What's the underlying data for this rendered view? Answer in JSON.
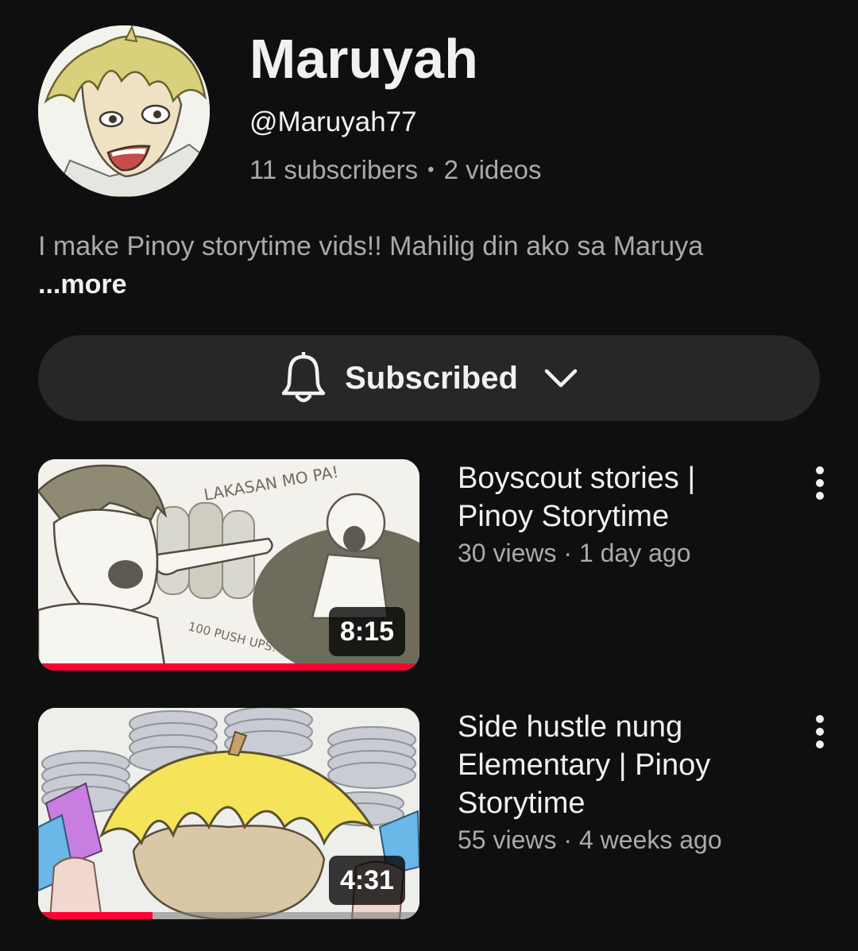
{
  "channel": {
    "name": "Maruyah",
    "handle": "@Maruyah77",
    "subscribers": "11 subscribers",
    "separator": "•",
    "videos": "2 videos",
    "description": "I make Pinoy storytime vids!! Mahilig din ako sa Maruya",
    "more_label": "...more",
    "avatar_icon": "avatar-anime-boy"
  },
  "subscribe_button": {
    "label": "Subscribed",
    "icon": "bell-icon",
    "dropdown_icon": "chevron-down-icon"
  },
  "videos": [
    {
      "title": "Boyscout stories | Pinoy Storytime",
      "views": "30 views",
      "age": "1 day ago",
      "meta": "30 views · 1 day ago",
      "duration": "8:15",
      "watched_fraction": 0.99,
      "thumb_text_top": "LAKASAN MO PA!",
      "thumb_text_bottom": "100 PUSH UPS!"
    },
    {
      "title": "Side hustle nung Elementary | Pinoy Storytime",
      "views": "55 views",
      "age": "4 weeks ago",
      "meta": "55 views · 4 weeks ago",
      "duration": "4:31",
      "watched_fraction": 0.3
    }
  ],
  "colors": {
    "background": "#0f0f0f",
    "button_bg": "#272727",
    "text_primary": "#f1f1f1",
    "text_secondary": "#aaaaaa",
    "progress": "#ff0033"
  }
}
